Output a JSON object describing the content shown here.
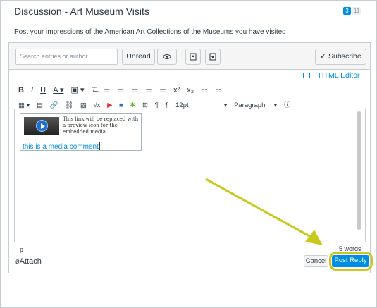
{
  "discussion": {
    "title": "Discussion - Art Museum Visits",
    "unread_count": "3",
    "total_count": "11",
    "message": "Post your impressions of the American Art Collections of the Museums you have visited"
  },
  "toolbar": {
    "search_placeholder": "Search entries or author",
    "unread_label": "Unread",
    "subscribe_label": "Subscribe"
  },
  "editor": {
    "html_editor_label": "HTML Editor",
    "font_size": "12pt",
    "block_format": "Paragraph",
    "media_placeholder": "This link will be replaced with a preview icon for the embedded media",
    "body_text": "this is a media comment",
    "path": "p",
    "word_count": "5 words"
  },
  "actions": {
    "attach_label": "Attach",
    "cancel_label": "Cancel",
    "post_label": "Post Reply"
  },
  "icons": [
    "eye-icon",
    "jump-up-icon",
    "jump-down-icon",
    "check-icon",
    "keyboard-icon",
    "paperclip-icon",
    "play-icon"
  ],
  "colors": {
    "accent": "#008ee2",
    "highlight": "#c7c91d"
  }
}
